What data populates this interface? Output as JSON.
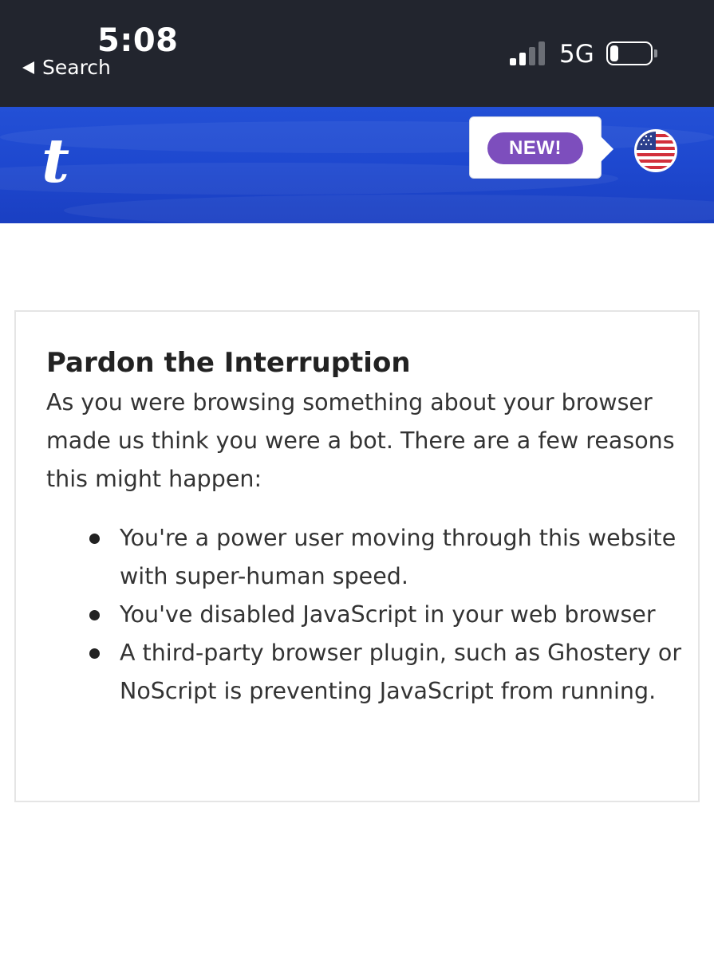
{
  "status_bar": {
    "time": "5:08",
    "back_label": "Search",
    "network": "5G",
    "signal_bars_active": 2,
    "signal_bars_total": 4,
    "battery_level": 0.2
  },
  "header": {
    "logo": "t",
    "badge_label": "NEW!",
    "flag_icon": "us-flag-icon",
    "colors": {
      "header_blue": "#1e48cf",
      "badge_purple": "#7d4ebd"
    }
  },
  "card": {
    "title": "Pardon the Interruption",
    "body": "As you were browsing something about your browser made us think you were a bot. There are a few reasons this might happen:",
    "reasons": [
      "You're a power user moving through this website with super-human speed.",
      "You've disabled JavaScript in your web browser",
      "A third-party browser plugin, such as Ghostery or NoScript is preventing JavaScript from running."
    ]
  }
}
